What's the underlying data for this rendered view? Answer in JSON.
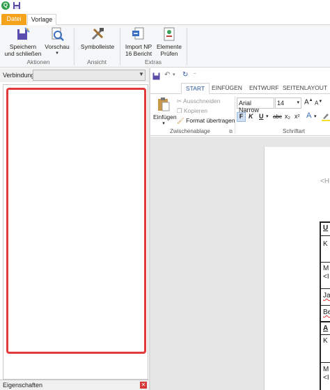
{
  "tabs": {
    "datei": "Datei",
    "vorlage": "Vorlage"
  },
  "ribbon": {
    "buttons": {
      "speichern": "Speichern\nund schließen",
      "speichern_l1": "Speichern",
      "speichern_l2": "und schließen",
      "vorschau": "Vorschau",
      "symbolleiste": "Symbolleiste",
      "import_l1": "Import NP",
      "import_l2": "16 Bericht",
      "elemente_l1": "Elemente",
      "elemente_l2": "Prüfen"
    },
    "groups": {
      "aktionen": "Aktionen",
      "ansicht": "Ansicht",
      "extras": "Extras"
    }
  },
  "left_panel": {
    "verbindung_label": "Verbindung",
    "verbindung_value": "",
    "eigenschaften_label": "Eigenschaften"
  },
  "word": {
    "tabs": [
      "START",
      "EINFÜGEN",
      "ENTWURF",
      "SEITENLAYOUT"
    ],
    "clipboard": {
      "paste": "Einfügen",
      "cut": "Ausschneiden",
      "copy": "Kopieren",
      "format": "Format übertragen",
      "group": "Zwischenablage"
    },
    "font": {
      "name": "Arial Narrow",
      "size": "14",
      "group": "Schriftart",
      "bold": "F",
      "italic": "K",
      "underline": "U",
      "strike": "abc",
      "sub": "x₂",
      "sup": "x²",
      "grow": "A",
      "shrink": "A"
    },
    "document": {
      "header_text": "<H",
      "cells": [
        "U",
        "K",
        "M",
        "<I",
        "Ja",
        "Be",
        "A",
        "K",
        "M",
        "<I"
      ]
    }
  },
  "colors": {
    "datei_tab": "#f7a21b",
    "accent": "#2b579a",
    "selection": "#e23a3a"
  }
}
